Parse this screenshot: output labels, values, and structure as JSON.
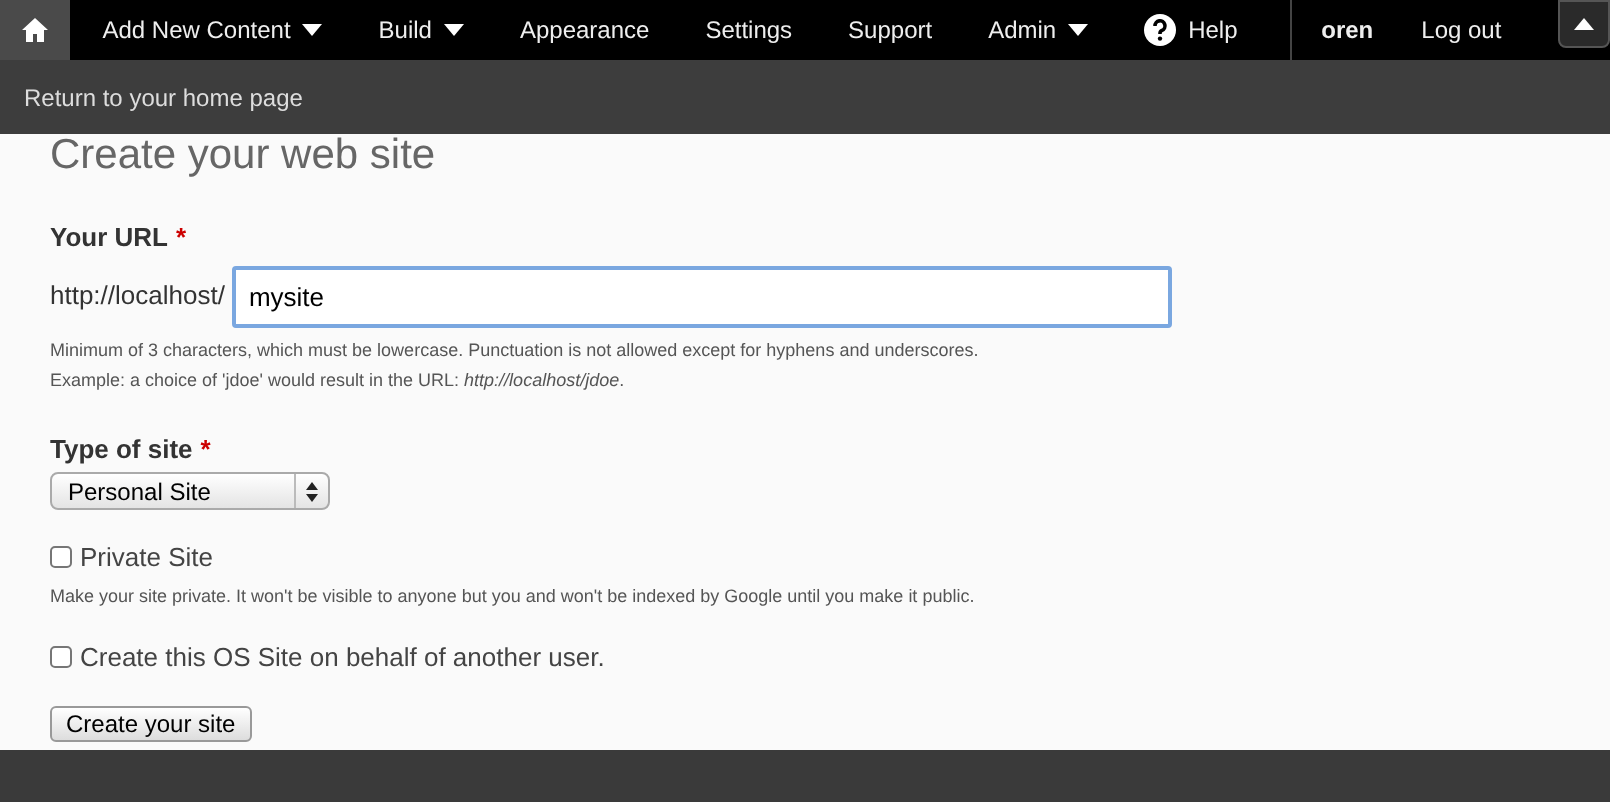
{
  "toolbar": {
    "menu": [
      {
        "label": "Add New Content",
        "dropdown": true
      },
      {
        "label": "Build",
        "dropdown": true
      },
      {
        "label": "Appearance",
        "dropdown": false
      },
      {
        "label": "Settings",
        "dropdown": false
      },
      {
        "label": "Support",
        "dropdown": false
      },
      {
        "label": "Admin",
        "dropdown": true
      },
      {
        "label": "Help",
        "dropdown": false
      }
    ],
    "user": "oren",
    "logout": "Log out"
  },
  "shortcut_bar": {
    "link": "Return to your home page"
  },
  "page_title": "Create your web site",
  "form": {
    "url": {
      "label": "Your URL",
      "required_mark": "*",
      "prefix": "http://localhost/",
      "value": "mysite",
      "description": "Minimum of 3 characters, which must be lowercase. Punctuation is not allowed except for hyphens and underscores.",
      "example": "Example: a choice of 'jdoe' would result in the URL: *http://localhost/jdoe*."
    },
    "site_type": {
      "label": "Type of site",
      "required_mark": "*",
      "value": "Personal Site"
    },
    "checkboxes": [
      {
        "label": "Private Site",
        "checked": false,
        "description": "Make your site private. It won't be visible to anyone but you and won't be indexed by Google until you make it public."
      },
      {
        "label": "Create this OS Site on behalf of another user.",
        "checked": false
      }
    ],
    "submit": "Create your site"
  }
}
